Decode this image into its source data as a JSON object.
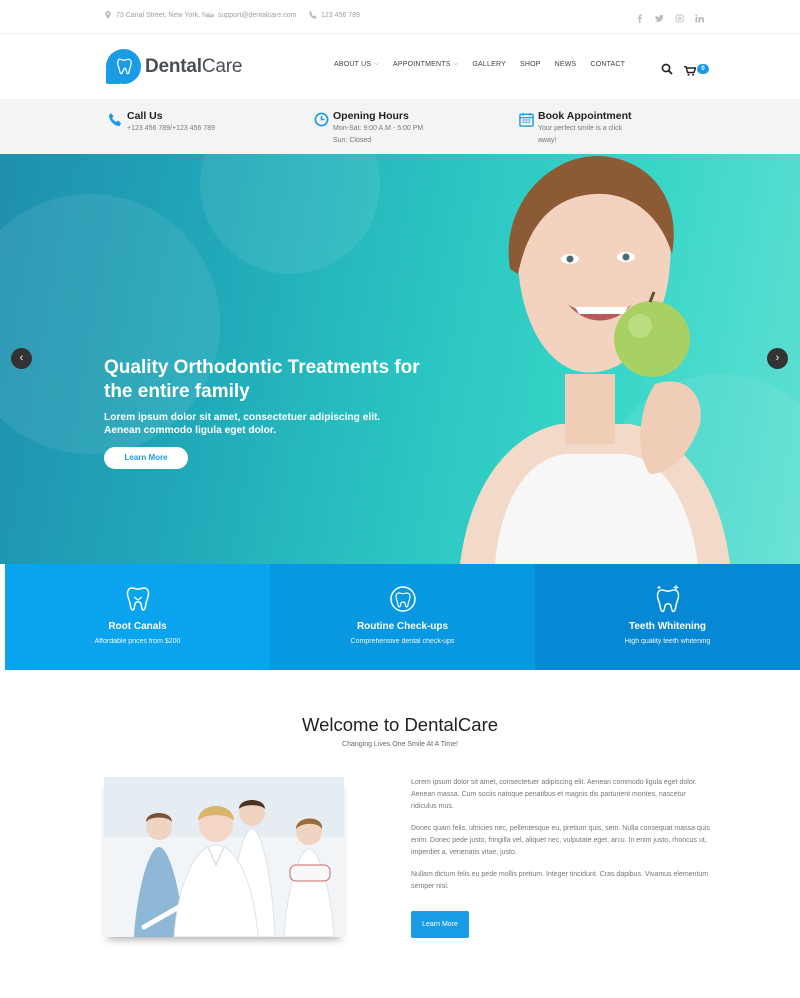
{
  "topbar": {
    "address": "73 Canal Street, New York, NY",
    "email": "support@dentalcare.com",
    "phone": "123 456 789",
    "socials": [
      "facebook-icon",
      "twitter-icon",
      "instagram-icon",
      "linkedin-icon"
    ]
  },
  "header": {
    "logo_bold": "Dental",
    "logo_light": "Care",
    "nav": [
      {
        "label": "ABOUT US",
        "dropdown": true
      },
      {
        "label": "APPOINTMENTS",
        "dropdown": true
      },
      {
        "label": "GALLERY",
        "dropdown": false
      },
      {
        "label": "SHOP",
        "dropdown": false
      },
      {
        "label": "NEWS",
        "dropdown": false
      },
      {
        "label": "CONTACT",
        "dropdown": false
      }
    ],
    "cart_count": "0"
  },
  "strip": {
    "call": {
      "title": "Call Us",
      "line1": "+123 456 789/+123 456 789"
    },
    "hours": {
      "title": "Opening Hours",
      "line1": "Mon-Sat: 9:00 A.M - 5:00 PM",
      "line2": "Sun: Closed"
    },
    "book": {
      "title": "Book Appointment",
      "line1": "Your perfect smile is a click away!"
    }
  },
  "hero": {
    "title": "Quality Orthodontic Treatments for the entire family",
    "subtitle": "Lorem ipsum dolor sit amet, consectetuer adipiscing elit. Aenean commodo ligula eget dolor.",
    "button": "Learn More",
    "prev": "‹",
    "next": "›"
  },
  "services": [
    {
      "title": "Root Canals",
      "sub": "Affordable prices from $200",
      "color": "#0aa3ee",
      "icon": "tooth-icon"
    },
    {
      "title": "Routine Check-ups",
      "sub": "Comprehensive dental check-ups",
      "color": "#0897e1",
      "icon": "tooth-checkup-icon"
    },
    {
      "title": "Teeth Whitening",
      "sub": "High quality teeth whitening",
      "color": "#0788d4",
      "icon": "sparkle-tooth-icon"
    }
  ],
  "welcome": {
    "title": "Welcome to DentalCare",
    "subtitle": "Changing Lives One Smile At A Time!",
    "p1": "Lorem ipsum dolor sit amet, consectetuer adipiscing elit. Aenean commodo ligula eget dolor. Aenean massa. Cum sociis natoque penatibus et magnis dis parturient montes, nascetur ridiculus mus.",
    "p2": "Donec quam felis, ultricies nec, pellentesque eu, pretium quis, sem. Nulla consequat massa quis enim. Donec pede justo, fringilla vel, aliquet nec, vulputate eget, arcu. In enim justo, rhoncus ut, imperdiet a, venenatis vitae, justo.",
    "p3": "Nullam dictum felis eu pede mollis pretium. Integer tincidunt. Cras dapibus. Vivamus elementum semper nisi.",
    "button": "Learn More"
  }
}
